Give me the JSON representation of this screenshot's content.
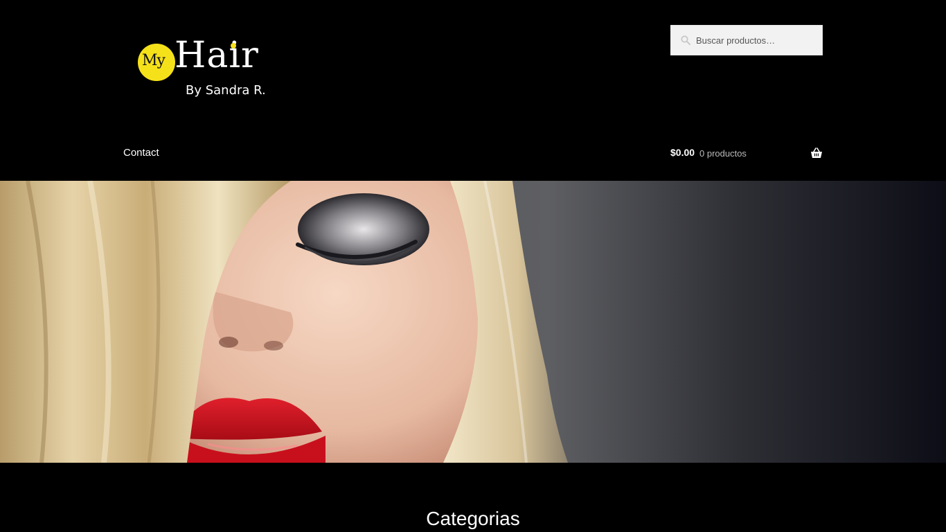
{
  "logo": {
    "my": "My",
    "hair": "Hair",
    "by": "By Sandra R."
  },
  "search": {
    "placeholder": "Buscar productos…"
  },
  "nav": {
    "contact": "Contact"
  },
  "cart": {
    "amount": "$0.00",
    "count": "0 productos"
  },
  "sections": {
    "categories_title": "Categorias"
  },
  "colors": {
    "background": "#000000",
    "logo_accent": "#f5e11a",
    "lip_red": "#d0101c",
    "search_bg": "#f2f2f2"
  },
  "icons": {
    "search": "search-icon",
    "cart": "basket-icon"
  }
}
